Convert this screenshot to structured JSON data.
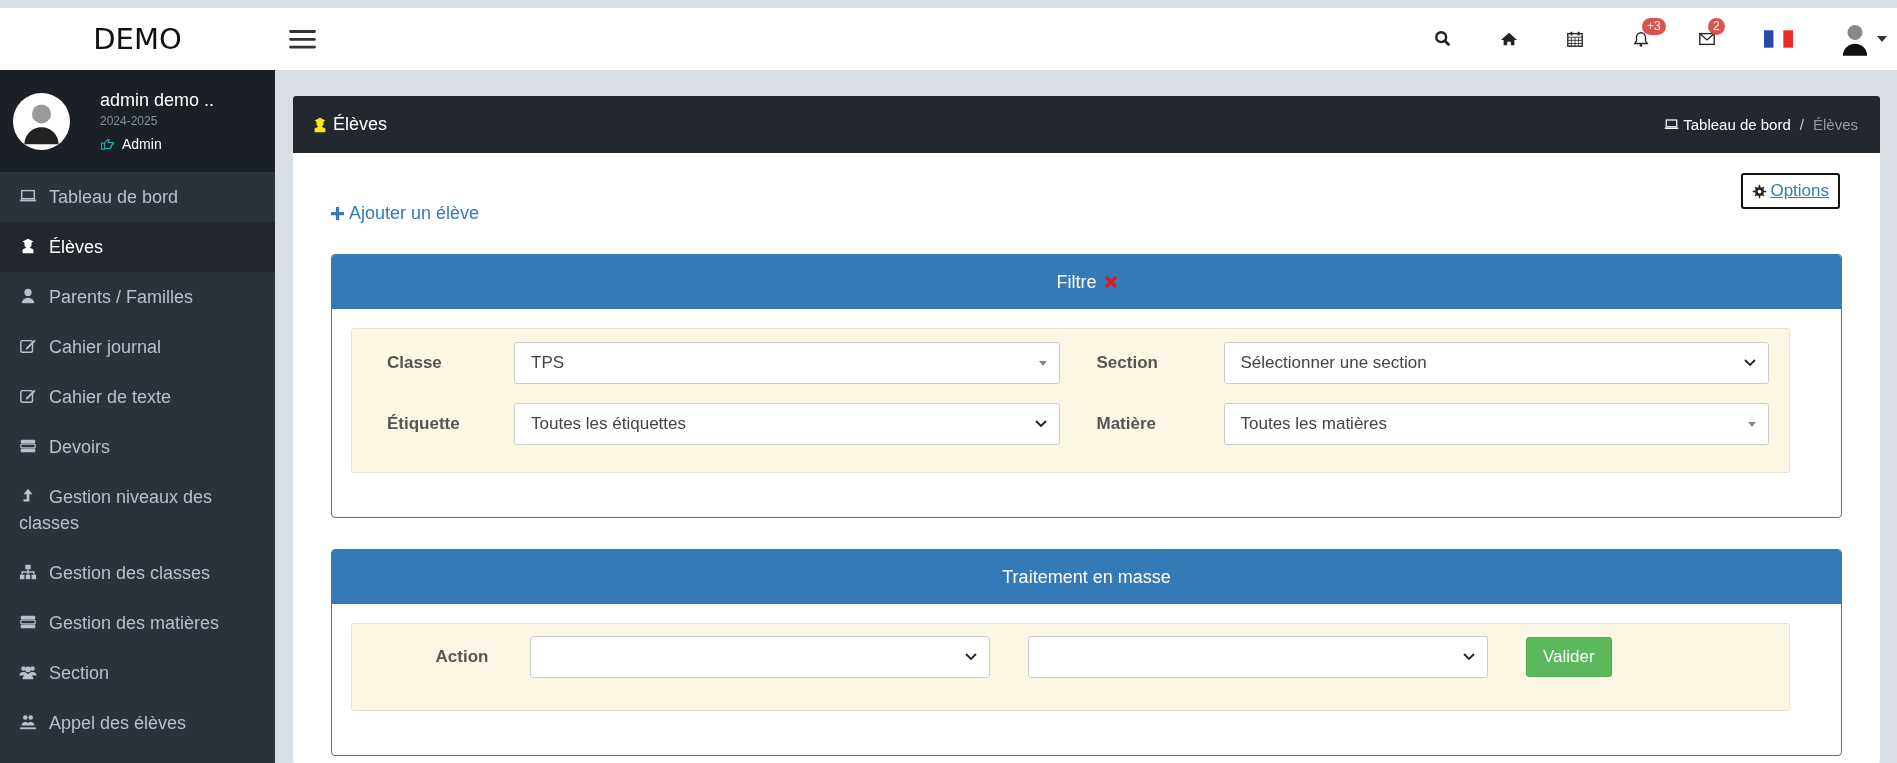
{
  "brand": "DEMO",
  "topbar_icons": [
    {
      "kind": "search"
    },
    {
      "kind": "home"
    },
    {
      "kind": "calendar"
    },
    {
      "kind": "bell",
      "badge": "+3"
    },
    {
      "kind": "mail",
      "badge": "2"
    },
    {
      "kind": "flag"
    },
    {
      "kind": "user"
    }
  ],
  "user": {
    "name": "admin demo ..",
    "year": "2024-2025",
    "role": "Admin"
  },
  "sidebar": {
    "items": [
      {
        "label": "Tableau de bord",
        "selected": false
      },
      {
        "label": "Élèves",
        "selected": true
      },
      {
        "label": "Parents / Familles",
        "selected": false
      },
      {
        "label": "Cahier journal",
        "selected": false
      },
      {
        "label": "Cahier de texte",
        "selected": false
      },
      {
        "label": "Devoirs",
        "selected": false
      },
      {
        "label": "Gestion niveaux des classes",
        "selected": false
      },
      {
        "label": "Gestion des classes",
        "selected": false
      },
      {
        "label": "Gestion des matières",
        "selected": false
      },
      {
        "label": "Section",
        "selected": false
      },
      {
        "label": "Appel des élèves",
        "selected": false
      }
    ]
  },
  "page": {
    "title": "Élèves",
    "breadcrumb": [
      "Tableau de bord",
      "Élèves"
    ],
    "breadcrumb_separator": "/",
    "add_link": "Ajouter un élève",
    "options_button": "Options"
  },
  "filter": {
    "title": "Filtre",
    "fields": [
      {
        "label": "Classe",
        "value": "TPS",
        "kind": "combo"
      },
      {
        "label": "Section",
        "value": "Sélectionner une section",
        "kind": "select"
      },
      {
        "label": "Étiquette",
        "value": "Toutes les étiquettes",
        "kind": "select"
      },
      {
        "label": "Matière",
        "value": "Toutes les matières",
        "kind": "combo"
      }
    ]
  },
  "mass": {
    "title": "Traitement en masse",
    "label": "Action",
    "button": "Valider"
  }
}
